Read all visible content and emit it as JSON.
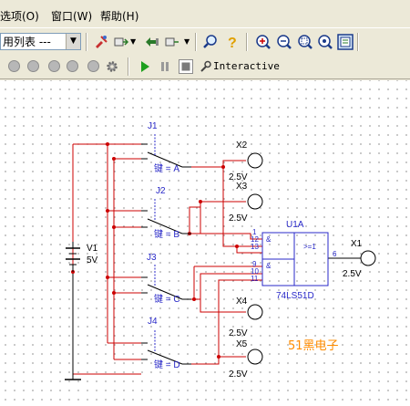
{
  "menu": {
    "items": [
      "选项(O)",
      "窗口(W)",
      "帮助(H)"
    ]
  },
  "toolbar": {
    "component_select": "用列表 ---"
  },
  "sim_toolbar": {
    "mode_label": "Interactive"
  },
  "icons": {
    "run": "play-icon",
    "pause": "pause-icon",
    "stop": "stop-icon",
    "help": "question-icon"
  },
  "colors": {
    "wire": "#cc0000",
    "component": "#2828c8",
    "watermark": "#ff8c00"
  },
  "circuit": {
    "switches": [
      {
        "ref": "J1",
        "key": "键 = A"
      },
      {
        "ref": "J2",
        "key": "键 = B"
      },
      {
        "ref": "J3",
        "key": "键 = C"
      },
      {
        "ref": "J4",
        "key": "键 = D"
      }
    ],
    "source": {
      "ref": "V1",
      "value": "5V"
    },
    "probes": [
      {
        "ref": "X2",
        "value": "2.5V"
      },
      {
        "ref": "X3",
        "value": "2.5V"
      },
      {
        "ref": "X4",
        "value": "2.5V"
      },
      {
        "ref": "X5",
        "value": "2.5V"
      },
      {
        "ref": "X1",
        "value": "2.5V"
      }
    ],
    "chip": {
      "ref": "U1A",
      "part": "74LS51D",
      "and1": "&",
      "and2": "&",
      "or": ">=1",
      "pins": [
        "1",
        "12",
        "13",
        "9",
        "10",
        "11",
        "6"
      ]
    },
    "watermark": "51黑电子"
  }
}
